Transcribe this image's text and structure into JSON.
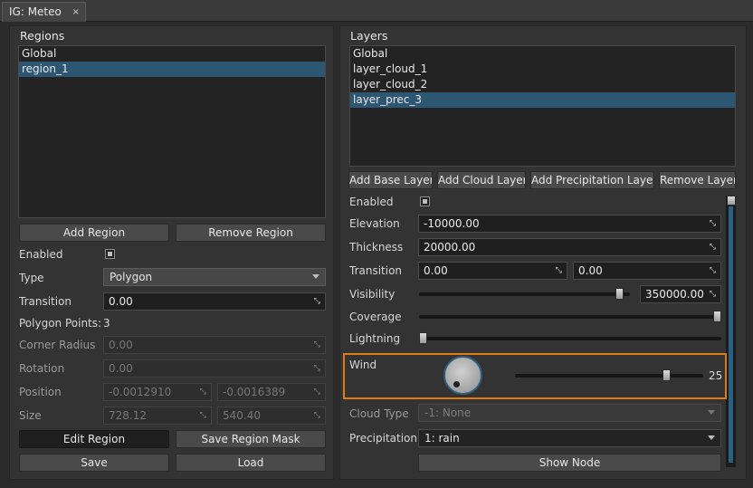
{
  "tab": {
    "title": "IG: Meteo",
    "close": "×"
  },
  "regions": {
    "title": "Regions",
    "items": [
      "Global",
      "region_1"
    ],
    "add_label": "Add Region",
    "remove_label": "Remove Region",
    "enabled_label": "Enabled",
    "type_label": "Type",
    "type_value": "Polygon",
    "transition_label": "Transition",
    "transition_value": "0.00",
    "polygon_points_label": "Polygon Points:",
    "polygon_points_value": "3",
    "corner_radius_label": "Corner Radius",
    "corner_radius_value": "0.00",
    "rotation_label": "Rotation",
    "rotation_value": "0.00",
    "position_label": "Position",
    "position_x": "-0.0012910",
    "position_y": "-0.0016389",
    "size_label": "Size",
    "size_x": "728.12",
    "size_y": "540.40",
    "edit_label": "Edit Region",
    "save_mask_label": "Save Region Mask",
    "save_label": "Save",
    "load_label": "Load"
  },
  "layers": {
    "title": "Layers",
    "items": [
      "Global",
      "layer_cloud_1",
      "layer_cloud_2",
      "layer_prec_3"
    ],
    "add_base_label": "Add Base Layer",
    "add_cloud_label": "Add Cloud Layer",
    "add_prec_label": "Add Precipitation Layer",
    "remove_label": "Remove Layer",
    "enabled_label": "Enabled",
    "elevation_label": "Elevation",
    "elevation_value": "-10000.00",
    "thickness_label": "Thickness",
    "thickness_value": "20000.00",
    "transition_label": "Transition",
    "transition_a": "0.00",
    "transition_b": "0.00",
    "visibility_label": "Visibility",
    "visibility_value": "350000.00",
    "visibility_level": 0.97,
    "coverage_label": "Coverage",
    "coverage_level": 1.0,
    "lightning_label": "Lightning",
    "lightning_level": 0.0,
    "wind_label": "Wind",
    "wind_value": "25",
    "wind_level": 0.82,
    "cloud_type_label": "Cloud Type",
    "cloud_type_value": "-1: None",
    "precipitation_label": "Precipitation",
    "precipitation_value": "1: rain",
    "show_node_label": "Show Node"
  },
  "colors": {
    "selection": "#2d5673",
    "highlight": "#e07b14",
    "scroll": "#2a6182"
  },
  "icons": {
    "field_arrow": "expand-arrows-icon",
    "combo_arrow": "chevron-down-icon",
    "wind_dial": "dial-icon"
  }
}
